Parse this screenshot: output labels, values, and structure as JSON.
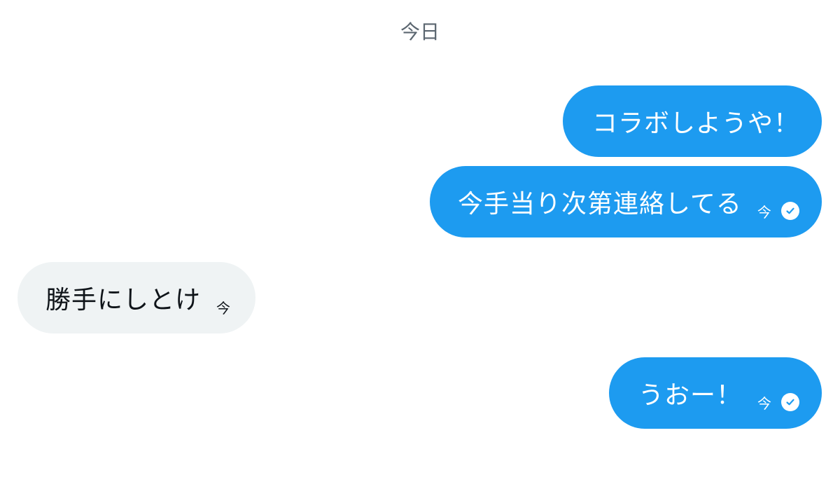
{
  "date_header": "今日",
  "messages": [
    {
      "direction": "sent",
      "text": "コラボしようや！",
      "time": "",
      "read": false
    },
    {
      "direction": "sent",
      "text": "今手当り次第連絡してる",
      "time": "今",
      "read": true
    },
    {
      "direction": "received",
      "text": "勝手にしとけ",
      "time": "今",
      "read": false
    },
    {
      "direction": "sent",
      "text": "うおー！",
      "time": "今",
      "read": true
    }
  ],
  "colors": {
    "sent_bubble": "#1d9bf0",
    "received_bubble": "#eff3f4",
    "date_text": "#5b6670"
  },
  "icons": {
    "read_receipt": "check-circle-icon"
  }
}
